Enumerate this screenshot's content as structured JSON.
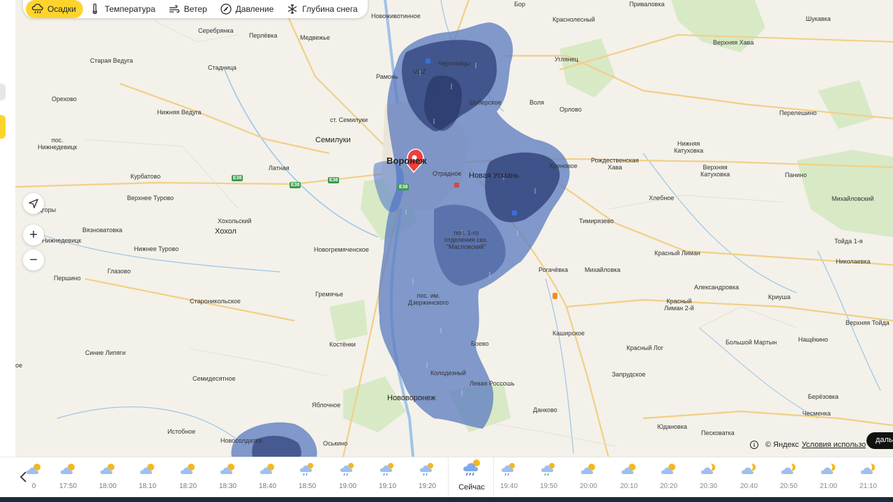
{
  "toolbar": {
    "tabs": [
      {
        "label": "Осадки",
        "icon": "precipitation-icon",
        "active": true
      },
      {
        "label": "Температура",
        "icon": "thermometer-icon",
        "active": false
      },
      {
        "label": "Ветер",
        "icon": "wind-icon",
        "active": false
      },
      {
        "label": "Давление",
        "icon": "pressure-icon",
        "active": false
      },
      {
        "label": "Глубина снега",
        "icon": "snowflake-icon",
        "active": false
      }
    ]
  },
  "map": {
    "colors": {
      "land": "#f3f1ea",
      "water": "#a8c8e8",
      "forest": "#d6e8c4",
      "road": "#f5d28a",
      "precip_light": "#5f7fc0",
      "precip_heavy": "#2d3f78",
      "marker": "#f23d3d"
    },
    "city": "Воронеж",
    "places": {
      "novozhivotinnoe": "Новоживотинное",
      "bor": "Бор",
      "krasnolesny": "Краснолесный",
      "privalovka": "Приваловка",
      "shukavka": "Шукавка",
      "verkhnyaya_khava": "Верхняя Хава",
      "serebryanka": "Серебрянка",
      "perlevka": "Перлёвка",
      "medvezhe": "Медвежье",
      "staraya_vedugа": "Старая Ведуга",
      "stadnitsa": "Стадница",
      "ramon": "Рамонь",
      "chertovitsy": "Чертовицы",
      "uglyanets": "Углянец",
      "orekhovo": "Орехово",
      "nizhnyaya_veduga": "Нижняя Ведуга",
      "shuberskoe": "Шуберское",
      "volya": "Воля",
      "orlovo": "Орлово",
      "pereleshino": "Перелешино",
      "pos_nizhnedevitsk": "пос.\nНижнедевицк",
      "st_semiluki": "ст. Семилуки",
      "semiluki": "Семилуки",
      "nizhnyaya_katukhovka": "Нижняя\nКатуховка",
      "latnaya": "Латная",
      "khrenovoe": "Хреновое",
      "rozhdestvenskaya_khava": "Рождественская\nХава",
      "verkhnyaya_katukhovka": "Верхняя\nКатуховка",
      "panino": "Панино",
      "kurbatovo": "Курбатово",
      "otradnoe": "Отрадное",
      "novaya_usman": "Новая Усмань",
      "mikhaylovsky": "Михайловский",
      "verkhnee_turovo": "Верхнее Турово",
      "khlebnoe": "Хлебное",
      "podgory": "Подгоры",
      "khokholsky": "Хохольский",
      "khokhol": "Хохол",
      "timiryazevo": "Тимирязево",
      "vyaznovatovka": "Вязноватовка",
      "pos_1go_otdeleniya": "пос. 1-го\nотделения свх.\n\"Масловский\"",
      "toyda": "Тойда 1-я",
      "nizhnedevitsk": "Нижнедевицк",
      "nizhnee_turovo": "Нижнее Турово",
      "novogremyachenskoe": "Новогремяченское",
      "krasny_liman": "Красный Лиман",
      "rogachevka": "Рогачёвка",
      "mikhaylovka": "Михайловка",
      "nikolaevka": "Николаевка",
      "glazovo": "Глазово",
      "pershino": "Першино",
      "aleksandrovka": "Александровка",
      "gremyache": "Гремячье",
      "krasny_liman_2": "Красный\nЛиман 2-й",
      "kriusha": "Криуша",
      "staronikolskoe": "Староникольское",
      "pos_dzerzhinskogo": "пос. им.\nДзержинского",
      "verkhnyaya_toyda": "Верхняя Тойда",
      "kashirskoe": "Каширское",
      "kostenki": "Костёнки",
      "bolshoy_martyn": "Большой Мартын",
      "nashchekino": "Нащёкино",
      "boevo": "Боево",
      "krasny_log": "Красный Лог",
      "sinie_lipyagi": "Синие Липяги",
      "oe": "ое",
      "kolodezny": "Колодезный",
      "zaprudskoe": "Запрудское",
      "semidesyatnoe": "Семидесятное",
      "levaya_rossosh": "Левая Россошь",
      "berezovka": "Берёзовка",
      "novovoronezh": "Нововоронеж",
      "yablochnoe": "Яблочное",
      "dankovo": "Данково",
      "chesmenka": "Чесменка",
      "istobnoe": "Истобное",
      "yudanovka": "Юдановка",
      "peskovatka": "Песковатка",
      "novosoldatka": "Новосолдатка",
      "oskino": "Оськино",
      "voz": "VOZ"
    },
    "roads": [
      "E38",
      "E38",
      "E38",
      "E38"
    ]
  },
  "controls": {
    "zoom_in": "+",
    "zoom_out": "−"
  },
  "copyright": {
    "text": "© Яндекс",
    "link": "Условия использо"
  },
  "further_button": "даль",
  "timeline": {
    "slots": [
      {
        "time": "0",
        "icon": "partly-cloudy-icon",
        "kind": "past"
      },
      {
        "time": "17:50",
        "icon": "partly-cloudy-icon",
        "kind": "past"
      },
      {
        "time": "18:00",
        "icon": "partly-cloudy-icon",
        "kind": "past"
      },
      {
        "time": "18:10",
        "icon": "partly-cloudy-icon",
        "kind": "past"
      },
      {
        "time": "18:20",
        "icon": "partly-cloudy-icon",
        "kind": "past"
      },
      {
        "time": "18:30",
        "icon": "partly-cloudy-icon",
        "kind": "past"
      },
      {
        "time": "18:40",
        "icon": "partly-cloudy-icon",
        "kind": "past"
      },
      {
        "time": "18:50",
        "icon": "light-rain-icon",
        "kind": "past"
      },
      {
        "time": "19:00",
        "icon": "light-rain-icon",
        "kind": "past"
      },
      {
        "time": "19:10",
        "icon": "light-rain-icon",
        "kind": "past"
      },
      {
        "time": "19:20",
        "icon": "light-rain-icon",
        "kind": "past"
      },
      {
        "time": "Сейчас",
        "icon": "rain-icon",
        "kind": "now"
      },
      {
        "time": "19:40",
        "icon": "light-rain-icon",
        "kind": "future"
      },
      {
        "time": "19:50",
        "icon": "light-rain-icon",
        "kind": "future"
      },
      {
        "time": "20:00",
        "icon": "partly-cloudy-icon",
        "kind": "future"
      },
      {
        "time": "20:10",
        "icon": "partly-cloudy-icon",
        "kind": "future"
      },
      {
        "time": "20:20",
        "icon": "partly-cloudy-icon",
        "kind": "future"
      },
      {
        "time": "20:30",
        "icon": "partly-cloudy-night-icon",
        "kind": "future"
      },
      {
        "time": "20:40",
        "icon": "partly-cloudy-night-icon",
        "kind": "future"
      },
      {
        "time": "20:50",
        "icon": "partly-cloudy-night-icon",
        "kind": "future"
      },
      {
        "time": "21:00",
        "icon": "partly-cloudy-night-icon",
        "kind": "future"
      },
      {
        "time": "21:10",
        "icon": "partly-cloudy-night-icon",
        "kind": "future"
      }
    ]
  }
}
